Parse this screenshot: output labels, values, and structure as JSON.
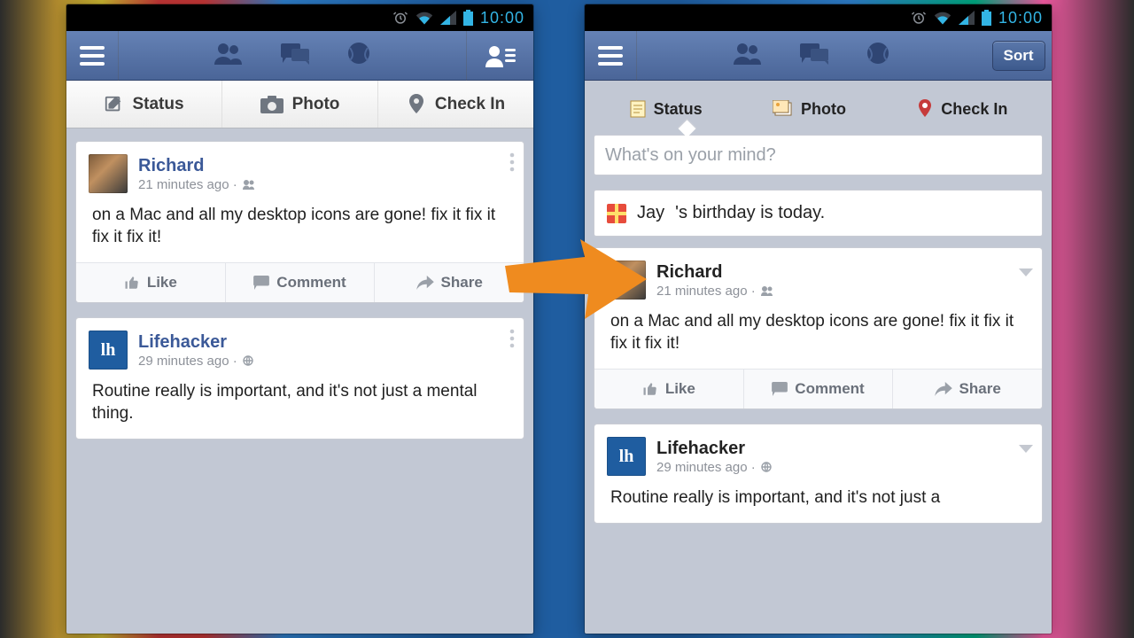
{
  "statusbar": {
    "time": "10:00"
  },
  "left": {
    "composer": {
      "status": "Status",
      "photo": "Photo",
      "checkin": "Check In"
    },
    "posts": [
      {
        "name": "Richard",
        "meta": "21 minutes ago · ",
        "meta_icon": "friends",
        "body": "on a Mac and all my desktop icons are gone! fix it fix it fix it fix it!",
        "avatar": "richard",
        "actions": {
          "like": "Like",
          "comment": "Comment",
          "share": "Share"
        }
      },
      {
        "name": "Lifehacker",
        "meta": "29 minutes ago · ",
        "meta_icon": "public",
        "body": "Routine really is important, and it's not just a mental thing.",
        "avatar": "lh"
      }
    ]
  },
  "right": {
    "sort_label": "Sort",
    "tabs": {
      "status": "Status",
      "photo": "Photo",
      "checkin": "Check In"
    },
    "mind_placeholder": "What's on your mind?",
    "birthday": {
      "name": "Jay",
      "suffix": "'s birthday is today."
    },
    "posts": [
      {
        "name": "Richard",
        "meta": "21 minutes ago · ",
        "meta_icon": "friends",
        "body": "on a Mac and all my desktop icons are gone! fix it fix it fix it fix it!",
        "avatar": "richard",
        "actions": {
          "like": "Like",
          "comment": "Comment",
          "share": "Share"
        }
      },
      {
        "name": "Lifehacker",
        "meta": "29 minutes ago · ",
        "meta_icon": "public",
        "body": "Routine really is important, and it's not just a",
        "avatar": "lh"
      }
    ]
  }
}
